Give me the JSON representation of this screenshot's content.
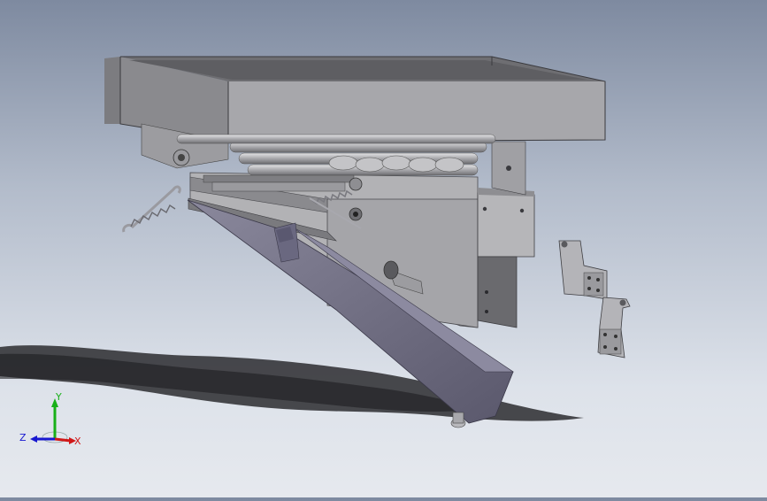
{
  "scene": {
    "model": "exploded-feeder-assembly",
    "colors": {
      "background_top": "#7e8aa0",
      "background_bottom": "#e6e9ee",
      "part_light": "#b8b8bb",
      "part_mid": "#9a9a9e",
      "part_dark": "#6c6c70",
      "chute": "#6f6d84",
      "shadow": "#2c2c30"
    }
  },
  "triad": {
    "x_label": "X",
    "y_label": "Y",
    "z_label": "Z",
    "x_color": "#d01818",
    "y_color": "#18b018",
    "z_color": "#1818d0"
  }
}
